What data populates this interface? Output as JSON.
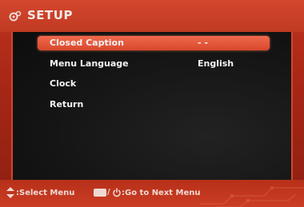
{
  "header": {
    "title": "SETUP",
    "icon": "gear-icon"
  },
  "menu": {
    "items": [
      {
        "label": "Closed Caption",
        "value": "- -",
        "selected": true
      },
      {
        "label": "Menu Language",
        "value": "English",
        "selected": false
      },
      {
        "label": "Clock",
        "value": "",
        "selected": false
      },
      {
        "label": "Return",
        "value": "",
        "selected": false
      }
    ]
  },
  "footer": {
    "select_text": ":Select Menu",
    "go_text": ":Go to Next Menu",
    "slash": "/",
    "icons": [
      "updown-arrow-icon",
      "enter-icon",
      "power-icon"
    ]
  },
  "colors": {
    "accent": "#d1452c",
    "highlight": "#e85a3d",
    "panel": "#141414",
    "text": "#f3f3f3"
  }
}
